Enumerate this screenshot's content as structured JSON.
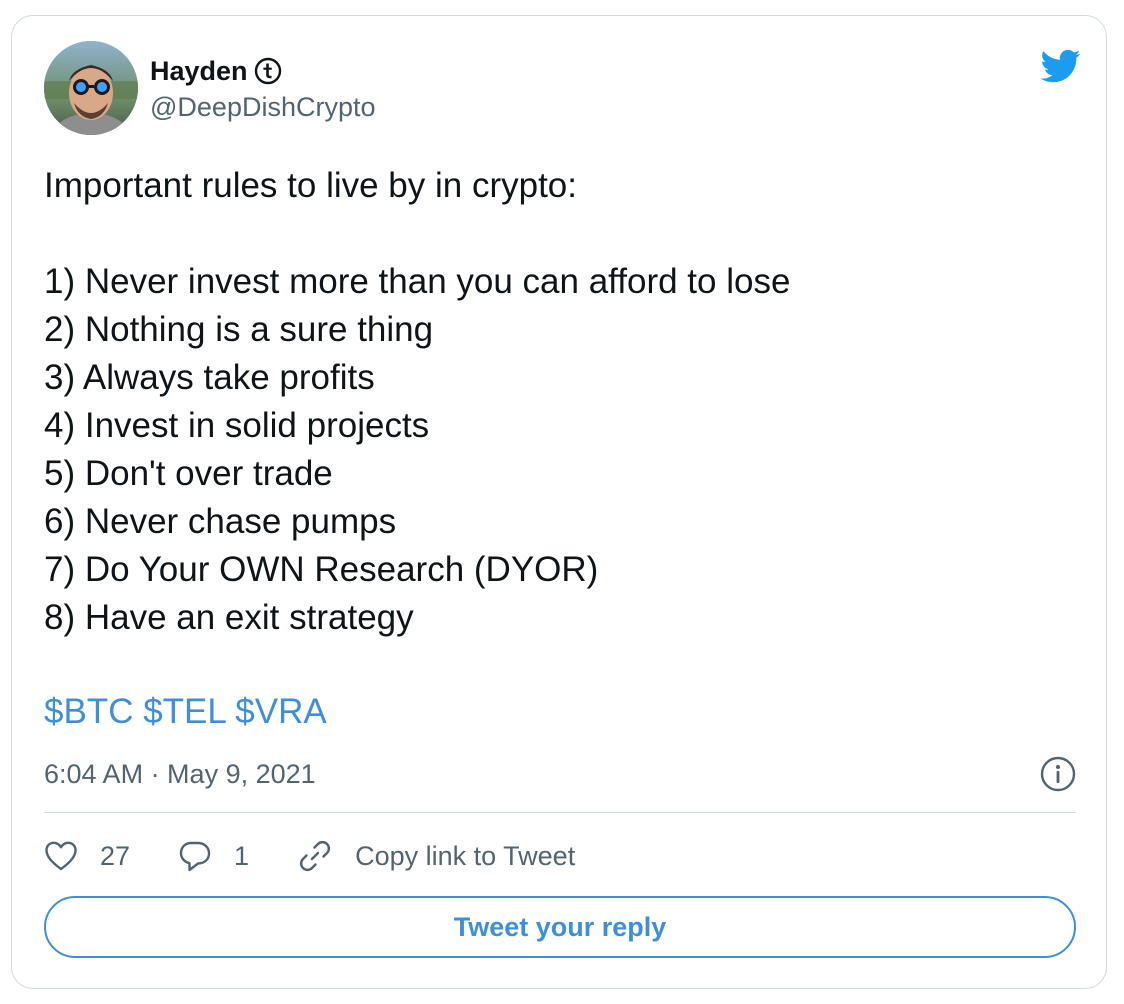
{
  "tweet": {
    "author": {
      "display_name": "Hayden",
      "handle": "@DeepDishCrypto",
      "name_badge_icon": "telcoin-t-icon",
      "avatar_icon": "avatar-photo"
    },
    "brand_icon": "twitter-bird-icon",
    "text_lines": [
      "Important rules to live by in crypto:",
      "",
      "1) Never invest more than you can afford to lose",
      "2) Nothing is a sure thing",
      "3) Always take profits",
      "4) Invest in solid projects",
      "5) Don't over trade",
      "6) Never chase pumps",
      "7) Do Your OWN Research (DYOR)",
      "8) Have an exit strategy"
    ],
    "cashtags": [
      "$BTC",
      "$TEL",
      "$VRA"
    ],
    "timestamp": "6:04 AM · May 9, 2021",
    "info_icon": "info-icon",
    "actions": {
      "likes": {
        "icon": "heart-icon",
        "count": "27"
      },
      "replies": {
        "icon": "reply-bubble-icon",
        "count": "1"
      },
      "copy_link": {
        "icon": "link-icon",
        "label": "Copy link to Tweet"
      }
    },
    "reply_button_label": "Tweet your reply",
    "colors": {
      "accent": "#3f8fd8",
      "text": "#0f1419",
      "secondary_text": "#536471",
      "border": "#cfd9de"
    }
  }
}
